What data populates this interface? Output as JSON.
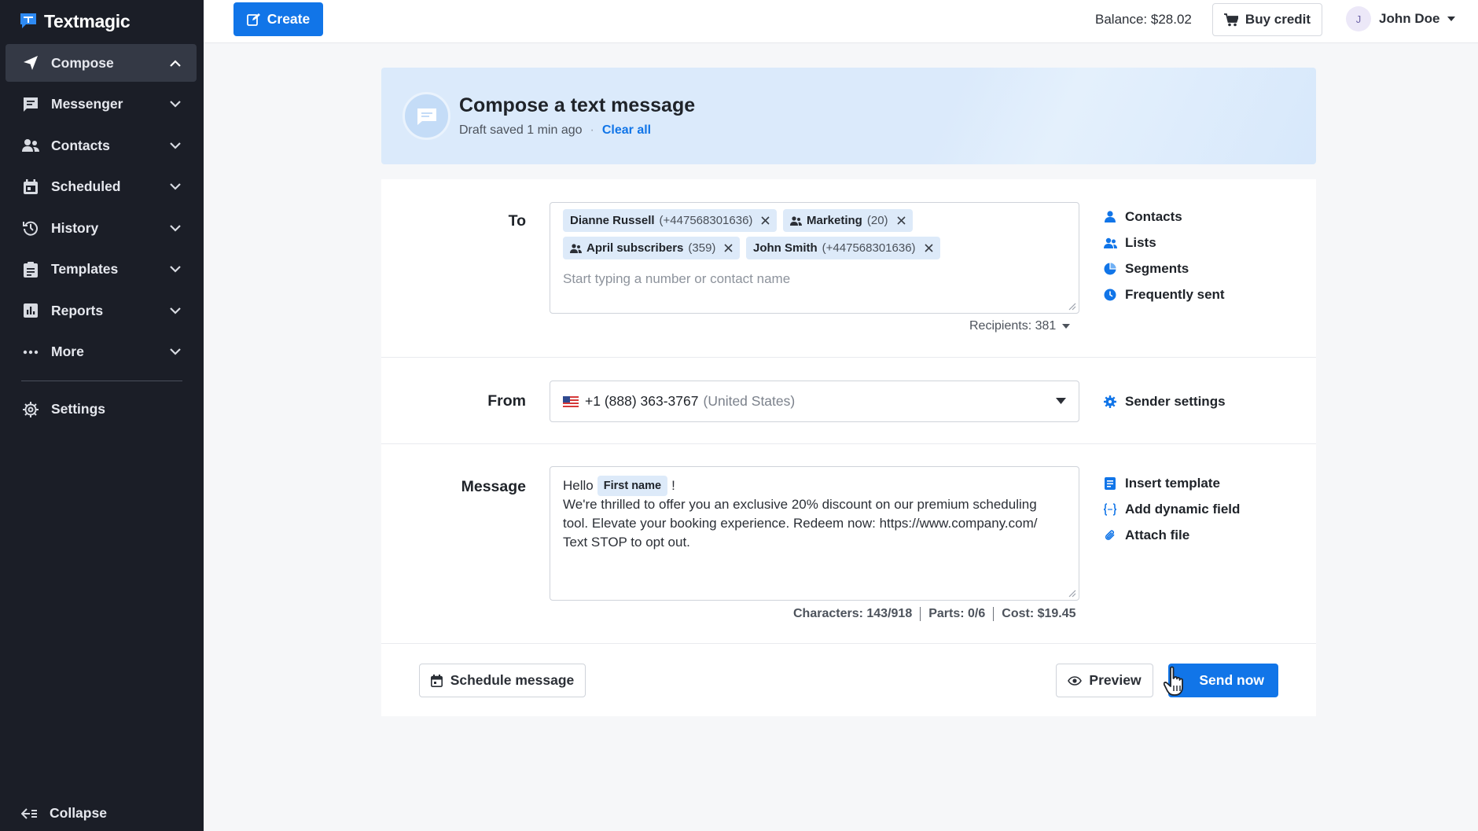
{
  "app": {
    "name": "Textmagic"
  },
  "sidebar": {
    "items": [
      {
        "label": "Compose",
        "icon": "paper-plane-icon",
        "active": true
      },
      {
        "label": "Messenger",
        "icon": "chat-icon"
      },
      {
        "label": "Contacts",
        "icon": "people-icon"
      },
      {
        "label": "Scheduled",
        "icon": "calendar-icon"
      },
      {
        "label": "History",
        "icon": "history-icon"
      },
      {
        "label": "Templates",
        "icon": "clipboard-icon"
      },
      {
        "label": "Reports",
        "icon": "bar-chart-icon"
      },
      {
        "label": "More",
        "icon": "more-dots-icon"
      }
    ],
    "settings_label": "Settings",
    "collapse_label": "Collapse"
  },
  "topbar": {
    "create_label": "Create",
    "balance": "Balance: $28.02",
    "buy_credit_label": "Buy credit",
    "user_initial": "J",
    "user_name": "John Doe"
  },
  "banner": {
    "title": "Compose a text message",
    "draft_status": "Draft saved 1 min ago",
    "separator": "·",
    "clear_label": "Clear all"
  },
  "compose": {
    "to_label": "To",
    "recipients": [
      {
        "name": "Dianne Russell",
        "detail": "(+447568301636)",
        "type": "contact"
      },
      {
        "name": "Marketing",
        "detail": "(20)",
        "type": "list"
      },
      {
        "name": "April subscribers",
        "detail": "(359)",
        "type": "list"
      },
      {
        "name": "John Smith",
        "detail": "(+447568301636)",
        "type": "contact"
      }
    ],
    "to_placeholder": "Start typing a number or contact name",
    "recipients_count": "Recipients: 381",
    "to_links": [
      "Contacts",
      "Lists",
      "Segments",
      "Frequently sent"
    ],
    "from_label": "From",
    "from_number": "+1 (888) 363-3767",
    "from_country": "(United States)",
    "sender_settings_label": "Sender settings",
    "message_label": "Message",
    "message_greeting": "Hello",
    "message_field": "First name",
    "message_after_field": "!",
    "message_body_1": "We're thrilled to offer you an exclusive 20% discount on our premium scheduling",
    "message_body_2": "tool. Elevate your booking experience. Redeem now: https://www.company.com/",
    "message_body_3": "Text STOP to opt out.",
    "message_links": [
      "Insert template",
      "Add dynamic field",
      "Attach file"
    ],
    "characters": "Characters: 143/918",
    "parts": "Parts: 0/6",
    "cost": "Cost: $19.45"
  },
  "actions": {
    "schedule_label": "Schedule message",
    "preview_label": "Preview",
    "send_label": "Send now"
  },
  "colors": {
    "primary": "#1175e8",
    "sidebar_bg": "#1b1e27",
    "chip_bg": "#ddeaf9",
    "banner_bg": "#dbeafb"
  }
}
